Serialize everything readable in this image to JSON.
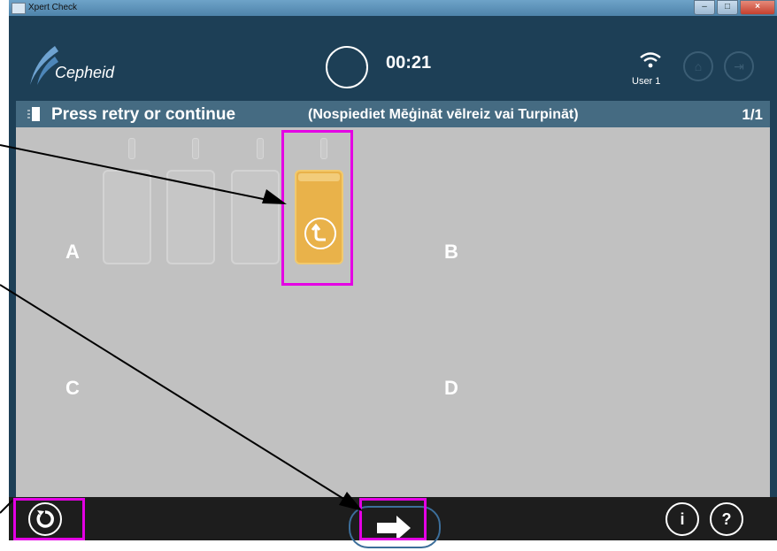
{
  "window": {
    "title": "Xpert Check"
  },
  "header": {
    "logo": "Cepheid",
    "timer": "00:21",
    "user": "User 1"
  },
  "step": {
    "title": "Press retry or continue",
    "subtitle": "(Nospiediet Mēģināt vēlreiz vai Turpināt)",
    "count": "1/1"
  },
  "modules": {
    "a": "A",
    "b": "B",
    "c": "C",
    "d": "D"
  },
  "cartridges": [
    {
      "status": "empty"
    },
    {
      "status": "empty"
    },
    {
      "status": "empty"
    },
    {
      "status": "retry"
    }
  ],
  "footer": {
    "retry_icon": "refresh-icon",
    "next_icon": "arrow-right-icon",
    "info": "i",
    "help": "?"
  },
  "colors": {
    "header": "#1d3f56",
    "step": "#456b82",
    "content": "#c1c1c1",
    "active_cartridge": "#e9b24a",
    "highlight": "#e400e4",
    "footer": "#1d1d1d"
  }
}
